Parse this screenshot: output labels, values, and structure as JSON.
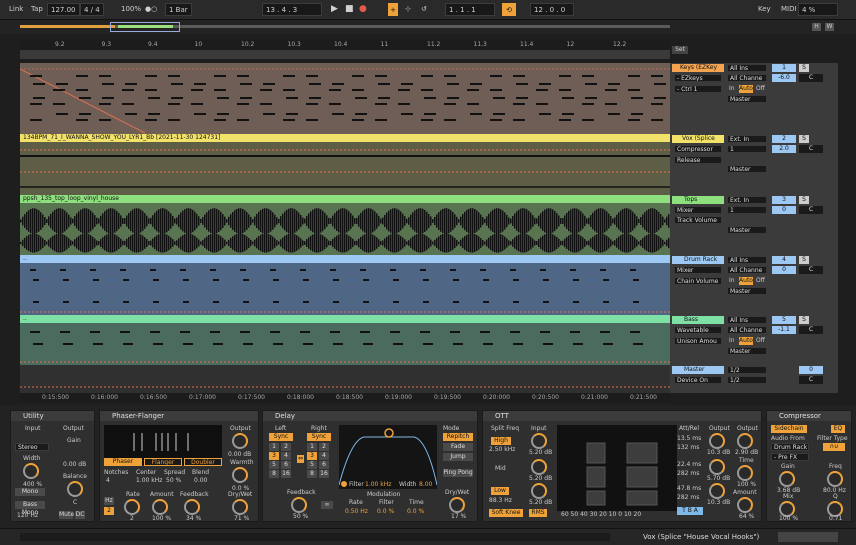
{
  "transport": {
    "link": "Link",
    "tap": "Tap",
    "tempo": "127.00",
    "sig": "4 / 4",
    "zoom": "100%",
    "circles": "●○",
    "quant": "1 Bar",
    "pos": "13 .  4 .  3",
    "loop_start": "1 .  1 .  1",
    "loop_len": "12 .  0 .  0",
    "key": "Key",
    "midi": "MIDI",
    "cpu": "4 %"
  },
  "ruler": [
    "9.2",
    "9.3",
    "9.4",
    "10",
    "10.2",
    "10.3",
    "10.4",
    "11",
    "11.2",
    "11.3",
    "11.4",
    "12",
    "12.2"
  ],
  "time_ruler": [
    "0:15:500",
    "0:16:000",
    "0:16:500",
    "0:17:000",
    "0:17:500",
    "0:18:000",
    "0:18:500",
    "0:19:000",
    "0:19:500",
    "0:20:000",
    "0:20:500",
    "0:21:000",
    "0:21:500"
  ],
  "mixer_header": {
    "set": "Set"
  },
  "tracks": [
    {
      "clip": "",
      "dev": "Keys (EZKey",
      "p1": "- EZkeys",
      "p2": "- Ctrl 1",
      "io": "All Ins",
      "io2": "All Channe",
      "in": "In",
      "auto": "Auto",
      "off": "Off",
      "out": "Master",
      "vol": "-6.0",
      "pan": "C",
      "s": "S",
      "n": "1"
    },
    {
      "clip": "134BPM_71_I_WANNA_SHOW_YOU_LYR1_Bb [2021-11-30 124731]",
      "dev": "Vox (Splice",
      "p1": "Compressor",
      "p2": "Release",
      "io": "Ext. In",
      "io2": "1",
      "out": "Master",
      "vol": "2.0",
      "pan": "C",
      "s": "S",
      "n": "2"
    },
    {
      "clip": "ppsh_135_top_loop_vinyl_house",
      "dev": "Tops",
      "p1": "Mixer",
      "p2": "Track Volume",
      "io": "Ext. In",
      "io2": "1",
      "out": "Master",
      "vol": "0",
      "pan": "C",
      "s": "S",
      "n": "3"
    },
    {
      "clip": "",
      "dev": "Drum Rack",
      "p1": "Mixer",
      "p2": "Chain Volume",
      "io": "All Ins",
      "io2": "All Channe",
      "in": "In",
      "auto": "Auto",
      "off": "Off",
      "out": "Master",
      "vol": "0",
      "pan": "C",
      "s": "S",
      "n": "4"
    },
    {
      "clip": "",
      "dev": "Bass",
      "p1": "Wavetable",
      "p2": "Unison Amou",
      "io": "All Ins",
      "io2": "All Channe",
      "in": "In",
      "auto": "Auto",
      "off": "Off",
      "out": "Master",
      "vol": "-1.1",
      "pan": "C",
      "s": "S",
      "n": "5"
    }
  ],
  "master": {
    "name": "Master",
    "p1": "Device On",
    "io": "1/2",
    "io2": "1/2",
    "vol": "0",
    "pan": "C"
  },
  "utility": {
    "title": "Utility",
    "input": "Input",
    "output": "Output",
    "stereo": "Stereo",
    "gain": "Gain",
    "gain_val": "0.00 dB",
    "width": "Width",
    "width_val": "400 %",
    "balance": "Balance",
    "balance_val": "C",
    "mono": "Mono",
    "bassmono": "Bass Mono",
    "bass_hz": "120 Hz",
    "mute": "Mute",
    "dc": "DC"
  },
  "phaser": {
    "title": "Phaser-Flanger",
    "output": "Output",
    "out_val": "0.00 dB",
    "warmth": "Warmth",
    "warmth_val": "0.0 %",
    "drywet": "Dry/Wet",
    "drywet_val": "71 %",
    "modes": [
      "Phaser",
      "Flanger",
      "Doubler"
    ],
    "notches": "Notches",
    "center": "Center",
    "spread": "Spread",
    "blend": "Blend",
    "notches_val": "4",
    "center_val": "1.00 kHz",
    "spread_val": "50 %",
    "blend_val": "0.00",
    "rate": "Rate",
    "rate_val": "2",
    "amount": "Amount",
    "amount_val": "100 %",
    "feedback": "Feedback",
    "feedback_val": "34 %",
    "hz": "Hz",
    "hz2": "2"
  },
  "delay": {
    "title": "Delay",
    "left": "Left",
    "right": "Right",
    "sync": "Sync",
    "steps": [
      "1",
      "2",
      "3",
      "4",
      "5",
      "6",
      "8",
      "16"
    ],
    "feedback": "Feedback",
    "feedback_val": "50 %",
    "filter": "Filter",
    "filter_val": "1.00 kHz",
    "width": "Width",
    "width_val": "8.00",
    "modulation": "Modulation",
    "rate": "Rate",
    "rate_val": "0.50 Hz",
    "mfilter": "Filter",
    "mfilter_val": "0.0 %",
    "time": "Time",
    "time_val": "0.0 %",
    "mode": "Mode",
    "modes": [
      "Repitch",
      "Fade",
      "Jump"
    ],
    "pingpong": "Ping Pong",
    "drywet": "Dry/Wet",
    "drywet_val": "17 %"
  },
  "ott": {
    "title": "OTT",
    "split": "Split Freq",
    "high": "High",
    "high_val": "2.50 kHz",
    "mid": "Mid",
    "low": "Low",
    "low_val": "88.3 Hz",
    "input": "Input",
    "in1": "5.20 dB",
    "in2": "5.20 dB",
    "in3": "5.20 dB",
    "softknee": "Soft Knee",
    "rms": "RMS",
    "attrel": "Att/Rel",
    "ar": [
      "13.5 ms",
      "132 ms",
      "22.4 ms",
      "282 ms",
      "47.8 ms",
      "282 ms"
    ],
    "scale": [
      "60",
      "50",
      "40",
      "30",
      "20",
      "10",
      "0",
      "10",
      "20"
    ],
    "output": "Output",
    "o1": "10.3 dB",
    "o2": "5.70 dB",
    "o3": "10.3 dB",
    "time": "Time",
    "time_val": "2.90 dB",
    "time_pct": "100 %",
    "amount": "Amount",
    "amount_val": "64 %",
    "tb": "T B A"
  },
  "comp": {
    "title": "Compressor",
    "sidechain": "Sidechain",
    "eq": "EQ",
    "audio_from": "Audio From",
    "drum": "Drum Rack",
    "prefx": "- Pre FX",
    "filter_type": "Filter Type",
    "gain": "Gain",
    "gain_val": "3.68 dB",
    "freq": "Freq",
    "freq_val": "80.0 Hz",
    "mix": "Mix",
    "mix_val": "100 %",
    "q": "Q",
    "q_val": "0.71"
  },
  "status": {
    "track": "Vox (Splice \"House Vocal Hooks\")"
  },
  "colors": {
    "t1": "#f4a34e",
    "t2": "#f3e26a",
    "t3": "#8ee07e",
    "t4": "#9cc8f3",
    "t5": "#7fe0a6",
    "accent": "#f0a23a"
  }
}
